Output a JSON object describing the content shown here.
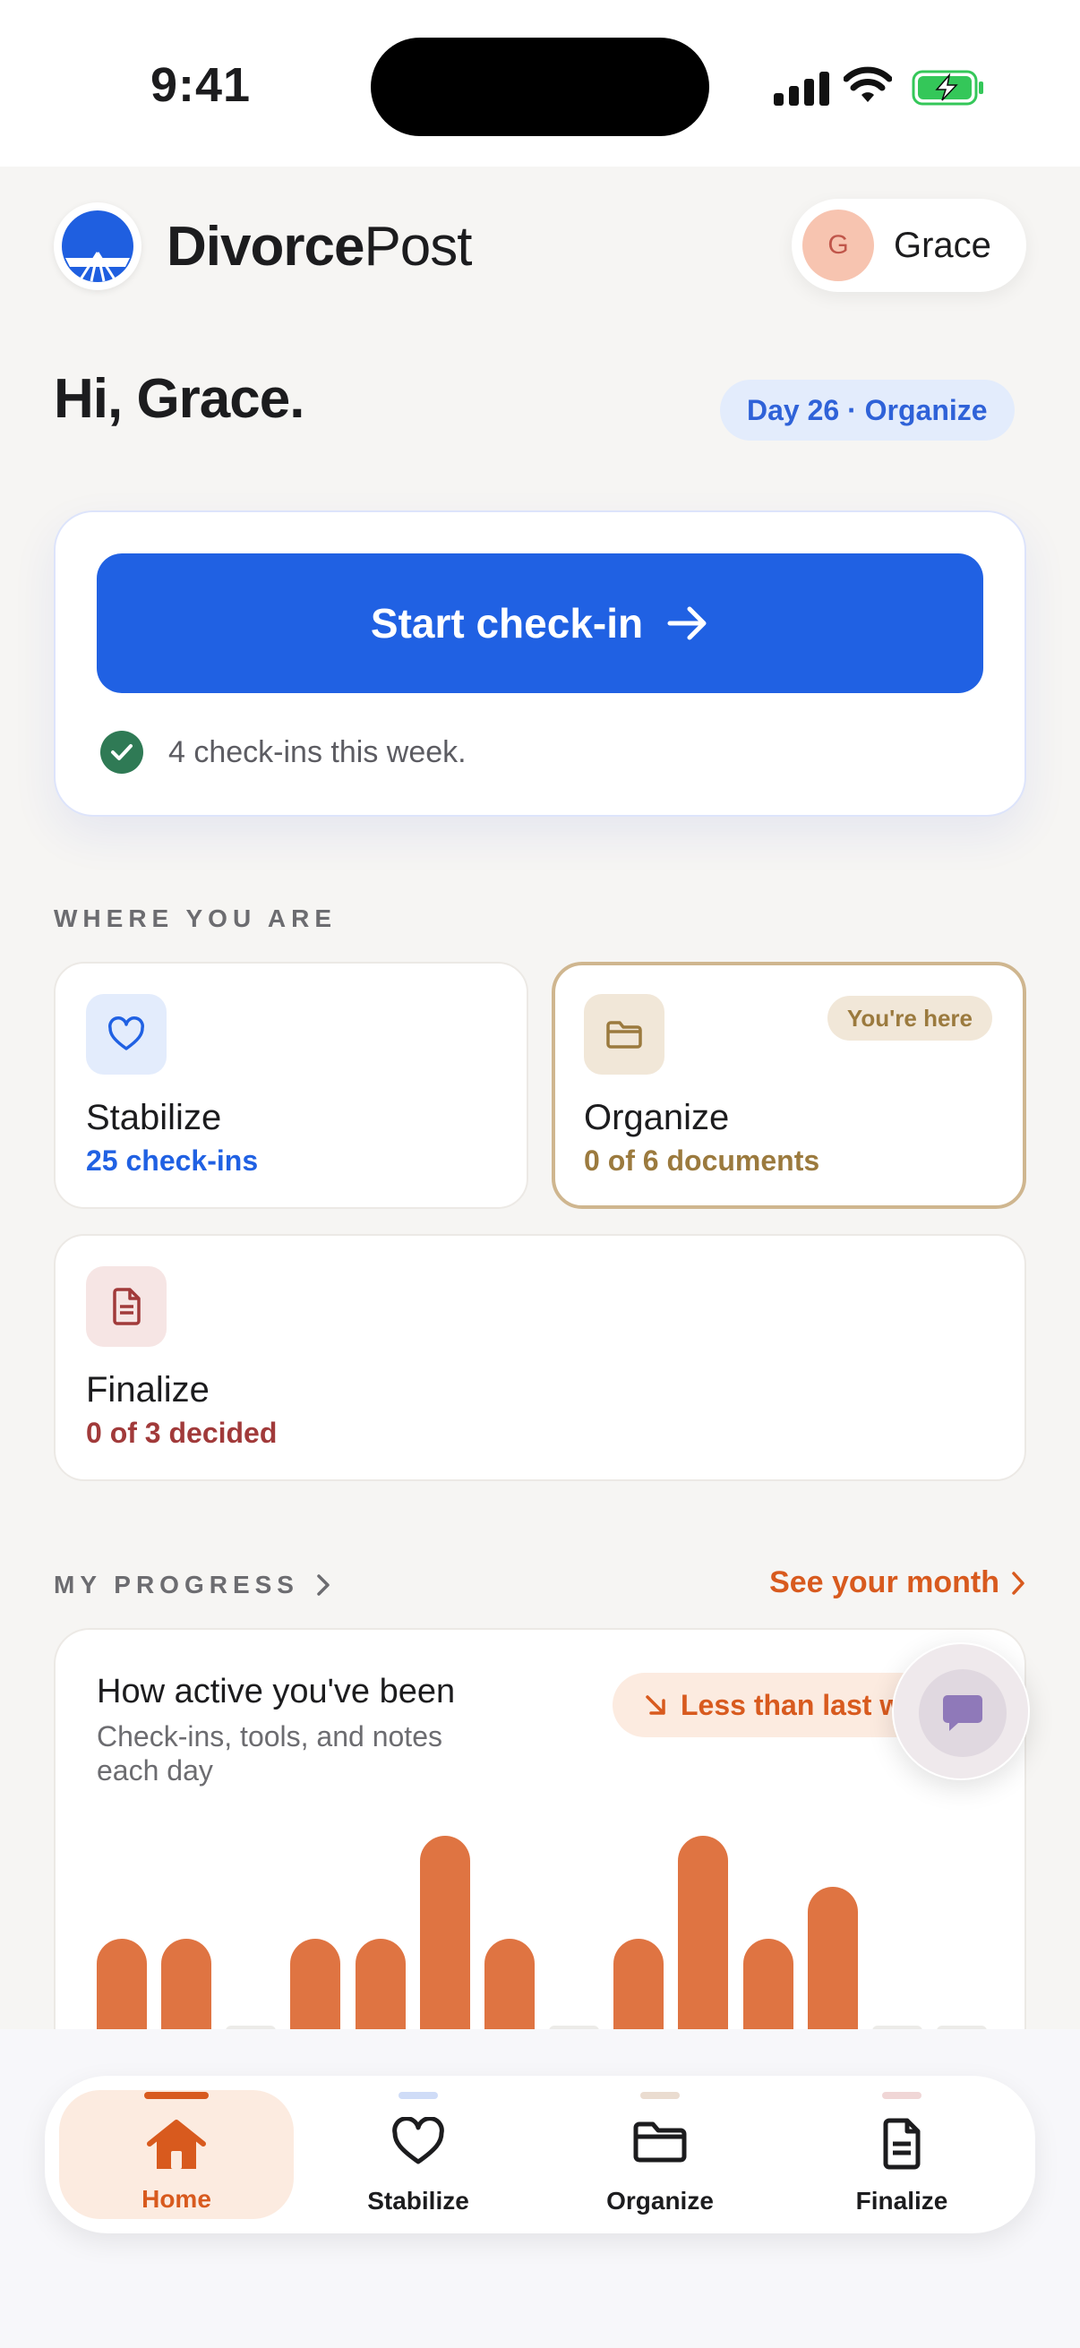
{
  "status_bar": {
    "time": "9:41"
  },
  "header": {
    "brand_bold": "Divorce",
    "brand_light": "Post",
    "user_initial": "G",
    "user_name": "Grace"
  },
  "greeting": {
    "text": "Hi, Grace.",
    "day_badge": "Day 26 · Organize"
  },
  "checkin": {
    "button_label": "Start check-in",
    "status_text": "4 check-ins this week."
  },
  "where_you_are": {
    "label": "WHERE YOU ARE",
    "phases": [
      {
        "title": "Stabilize",
        "subtitle": "25 check-ins",
        "icon": "heart-icon",
        "color": "#2061e3"
      },
      {
        "title": "Organize",
        "subtitle": "0 of 6 documents",
        "icon": "folder-icon",
        "color": "#9b7a3e",
        "badge": "You're here"
      },
      {
        "title": "Finalize",
        "subtitle": "0 of 3 decided",
        "icon": "document-icon",
        "color": "#a13a3a"
      }
    ]
  },
  "progress": {
    "label": "MY PROGRESS",
    "see_month": "See your month",
    "card_title": "How active you've been",
    "card_subtitle": "Check-ins, tools, and notes each day",
    "trend_badge": "Less than last w"
  },
  "chart_data": {
    "type": "bar",
    "values": [
      2,
      2,
      0,
      2,
      2,
      4,
      2,
      0,
      2,
      4,
      2,
      3,
      0,
      0
    ],
    "ylim": [
      0,
      4
    ],
    "color": "#df7442"
  },
  "tabbar": {
    "tabs": [
      {
        "label": "Home",
        "icon": "home-icon",
        "active": true
      },
      {
        "label": "Stabilize",
        "icon": "heart-icon",
        "active": false
      },
      {
        "label": "Organize",
        "icon": "folder-icon",
        "active": false
      },
      {
        "label": "Finalize",
        "icon": "document-icon",
        "active": false
      }
    ]
  }
}
